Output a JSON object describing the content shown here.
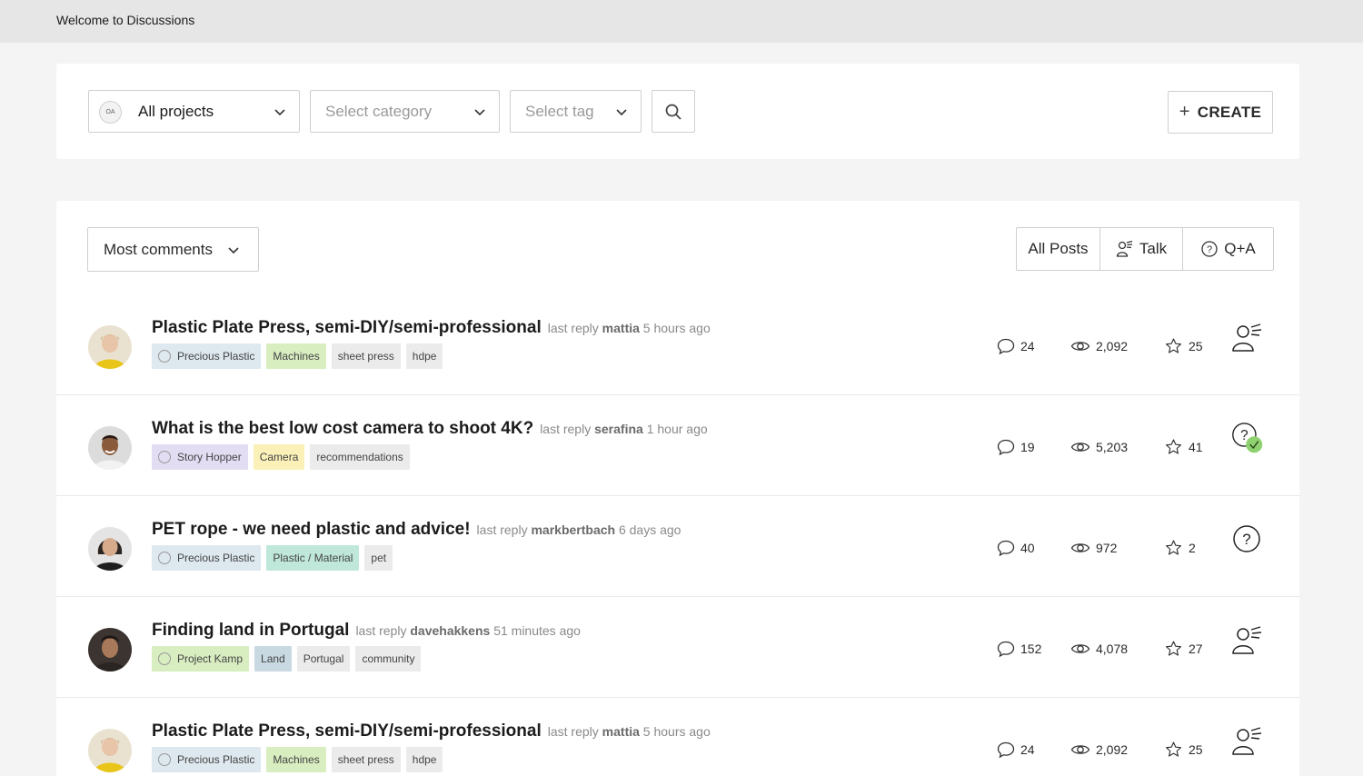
{
  "header": {
    "title": "Welcome to Discussions"
  },
  "filters": {
    "project_badge": "OA",
    "project_label": "All projects",
    "category_placeholder": "Select category",
    "tag_placeholder": "Select tag",
    "create_label": "CREATE"
  },
  "sort": {
    "label": "Most comments"
  },
  "segments": {
    "all": "All Posts",
    "talk": "Talk",
    "qa": "Q+A"
  },
  "colors": {
    "accent_check": "#8fd170",
    "tag_blue": "#dde8ef",
    "tag_green": "#d8edc0",
    "tag_yellow": "#fbf0b8",
    "tag_teal": "#bfe7da",
    "tag_lavender": "#e3ddf4",
    "tag_grey": "#ebebeb"
  },
  "posts": [
    {
      "title": "Plastic Plate Press, semi-DIY/semi-professional",
      "last_reply_prefix": "last reply",
      "user": "mattia",
      "time": "5 hours ago",
      "avatar": "avatar-yellow",
      "tags": [
        {
          "label": "Precious Plastic",
          "color": "#dde8ef",
          "project": true
        },
        {
          "label": "Machines",
          "color": "#d8edc0"
        },
        {
          "label": "sheet press",
          "color": "#ebebeb"
        },
        {
          "label": "hdpe",
          "color": "#ebebeb"
        }
      ],
      "comments": "24",
      "views": "2,092",
      "stars": "25",
      "type": "talk"
    },
    {
      "title": "What is the best low cost camera to shoot 4K?",
      "last_reply_prefix": "last reply",
      "user": "serafina",
      "time": "1 hour ago",
      "avatar": "avatar-man",
      "tags": [
        {
          "label": "Story Hopper",
          "color": "#e3ddf4",
          "project": true
        },
        {
          "label": "Camera",
          "color": "#fbf0b8"
        },
        {
          "label": "recommendations",
          "color": "#ebebeb"
        }
      ],
      "comments": "19",
      "views": "5,203",
      "stars": "41",
      "type": "qa-solved"
    },
    {
      "title": "PET rope - we need plastic and advice!",
      "last_reply_prefix": "last reply",
      "user": "markbertbach",
      "time": "6 days ago",
      "avatar": "avatar-woman",
      "tags": [
        {
          "label": "Precious Plastic",
          "color": "#dde8ef",
          "project": true
        },
        {
          "label": "Plastic / Material",
          "color": "#bfe7da"
        },
        {
          "label": "pet",
          "color": "#ebebeb"
        }
      ],
      "comments": "40",
      "views": "972",
      "stars": "2",
      "type": "qa"
    },
    {
      "title": "Finding land in Portugal",
      "last_reply_prefix": "last reply",
      "user": "davehakkens",
      "time": "51 minutes ago",
      "avatar": "avatar-dark",
      "tags": [
        {
          "label": "Project Kamp",
          "color": "#d8edc0",
          "project": true
        },
        {
          "label": "Land",
          "color": "#c9d9e2"
        },
        {
          "label": "Portugal",
          "color": "#ebebeb"
        },
        {
          "label": "community",
          "color": "#ebebeb"
        }
      ],
      "comments": "152",
      "views": "4,078",
      "stars": "27",
      "type": "talk"
    },
    {
      "title": "Plastic Plate Press, semi-DIY/semi-professional",
      "last_reply_prefix": "last reply",
      "user": "mattia",
      "time": "5 hours ago",
      "avatar": "avatar-yellow",
      "tags": [
        {
          "label": "Precious Plastic",
          "color": "#dde8ef",
          "project": true
        },
        {
          "label": "Machines",
          "color": "#d8edc0"
        },
        {
          "label": "sheet press",
          "color": "#ebebeb"
        },
        {
          "label": "hdpe",
          "color": "#ebebeb"
        }
      ],
      "comments": "24",
      "views": "2,092",
      "stars": "25",
      "type": "talk"
    }
  ]
}
